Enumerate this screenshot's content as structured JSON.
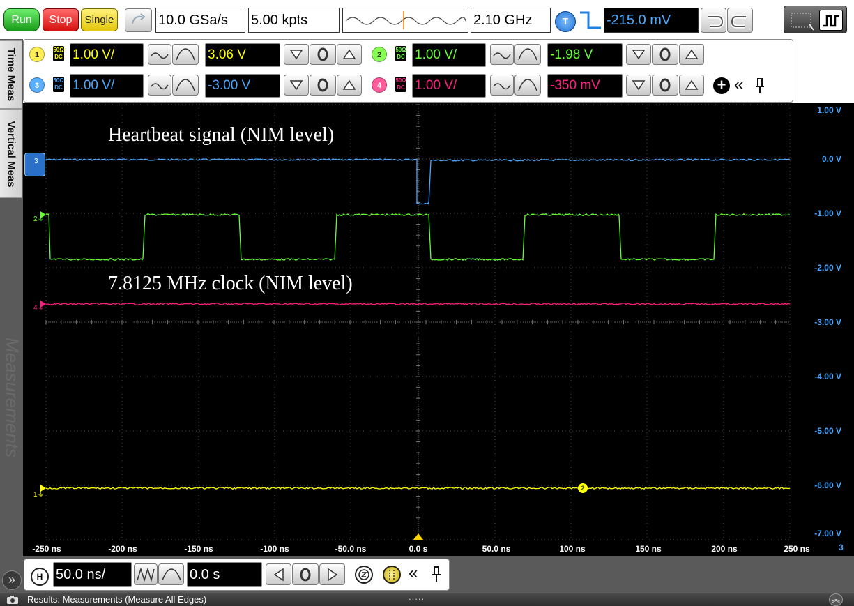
{
  "toolbar": {
    "run_label": "Run",
    "stop_label": "Stop",
    "single_label": "Single",
    "sample_rate": "10.0 GSa/s",
    "memory_depth": "5.00 kpts",
    "bandwidth": "2.10 GHz",
    "trigger_badge": "T",
    "trigger_level": "-215.0 mV"
  },
  "channels": [
    {
      "num": "1",
      "coupling_top": "50Ω",
      "coupling_bottom": "DC",
      "scale": "1.00 V/",
      "offset": "3.06 V",
      "color": "#ffff00"
    },
    {
      "num": "2",
      "coupling_top": "50Ω",
      "coupling_bottom": "DC",
      "scale": "1.00 V/",
      "offset": "-1.98 V",
      "color": "#66ff33"
    },
    {
      "num": "3",
      "coupling_top": "50Ω",
      "coupling_bottom": "DC",
      "scale": "1.00 V/",
      "offset": "-3.00 V",
      "color": "#4aa8ff"
    },
    {
      "num": "4",
      "coupling_top": "50Ω",
      "coupling_bottom": "DC",
      "scale": "1.00 V/",
      "offset": "-350 mV",
      "color": "#ff2080"
    }
  ],
  "side_tabs": {
    "time_meas": "Time Meas",
    "vertical_meas": "Vertical Meas",
    "measurements": "Measurements"
  },
  "screen": {
    "annotation_top": "Heartbeat signal (NIM level)",
    "annotation_bottom": "7.8125 MHz clock (NIM level)",
    "y_labels": [
      "1.00 V",
      "0.0 V",
      "-1.00 V",
      "-2.00 V",
      "-3.00 V",
      "-4.00 V",
      "-5.00 V",
      "-6.00 V",
      "-7.00 V"
    ],
    "x_labels": [
      "-250 ns",
      "-200 ns",
      "-150 ns",
      "-100 ns",
      "-50.0 ns",
      "0.0 s",
      "50.0 ns",
      "100 ns",
      "150 ns",
      "200 ns",
      "250 ns"
    ],
    "right_edge_mark": "3",
    "marker_3": "3",
    "marker_2": "2",
    "marker_4": "4",
    "marker_1": "1",
    "cursor_marker": "2"
  },
  "horizontal": {
    "badge": "H",
    "timebase": "50.0 ns/",
    "position": "0.0 s"
  },
  "status_bar": {
    "results_text": "Results: Measurements (Measure All Edges)",
    "handle": "....."
  },
  "colors": {
    "ch1": "#ffff00",
    "ch2": "#66ff33",
    "ch3": "#4aa8ff",
    "ch4": "#ff2080",
    "run": "#22bb22",
    "stop": "#ee2222",
    "single": "#f2e020"
  }
}
